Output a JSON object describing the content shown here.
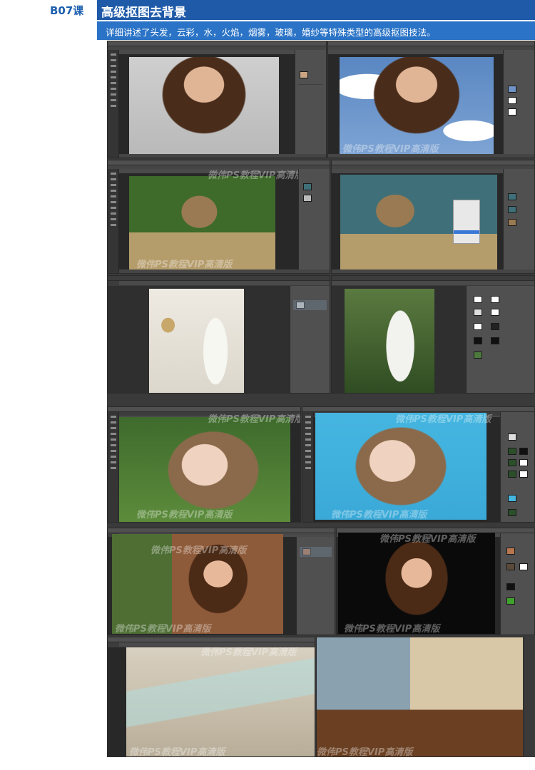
{
  "header": {
    "lesson_code": "B07课",
    "title": "高级抠图去背景",
    "subtitle": "详细讲述了头发，云彩，水，火焰，烟雾，玻璃，婚纱等特殊类型的高级抠图技法。"
  },
  "watermark_text": "微伟PS教程VIP高清版",
  "rows": [
    {
      "left": "woman-original",
      "right": "woman-sky-background"
    },
    {
      "left": "kitten-green-background",
      "right": "kitten-teal-background"
    },
    {
      "left": "bride-white-background",
      "right": "bride-forest-background"
    },
    {
      "left": "girl-flowers-background",
      "right": "girl-cyan-background"
    },
    {
      "left": "girl-garden-background",
      "right": "girl-black-background"
    },
    {
      "left": "glass-table-original",
      "right": "living-room-composite"
    }
  ],
  "colors": {
    "title_bar": "#1f5aa8",
    "subtitle_bar": "#2a73c6",
    "lesson_code": "#1c5fae",
    "ps_ui": "#3c3c3c"
  }
}
